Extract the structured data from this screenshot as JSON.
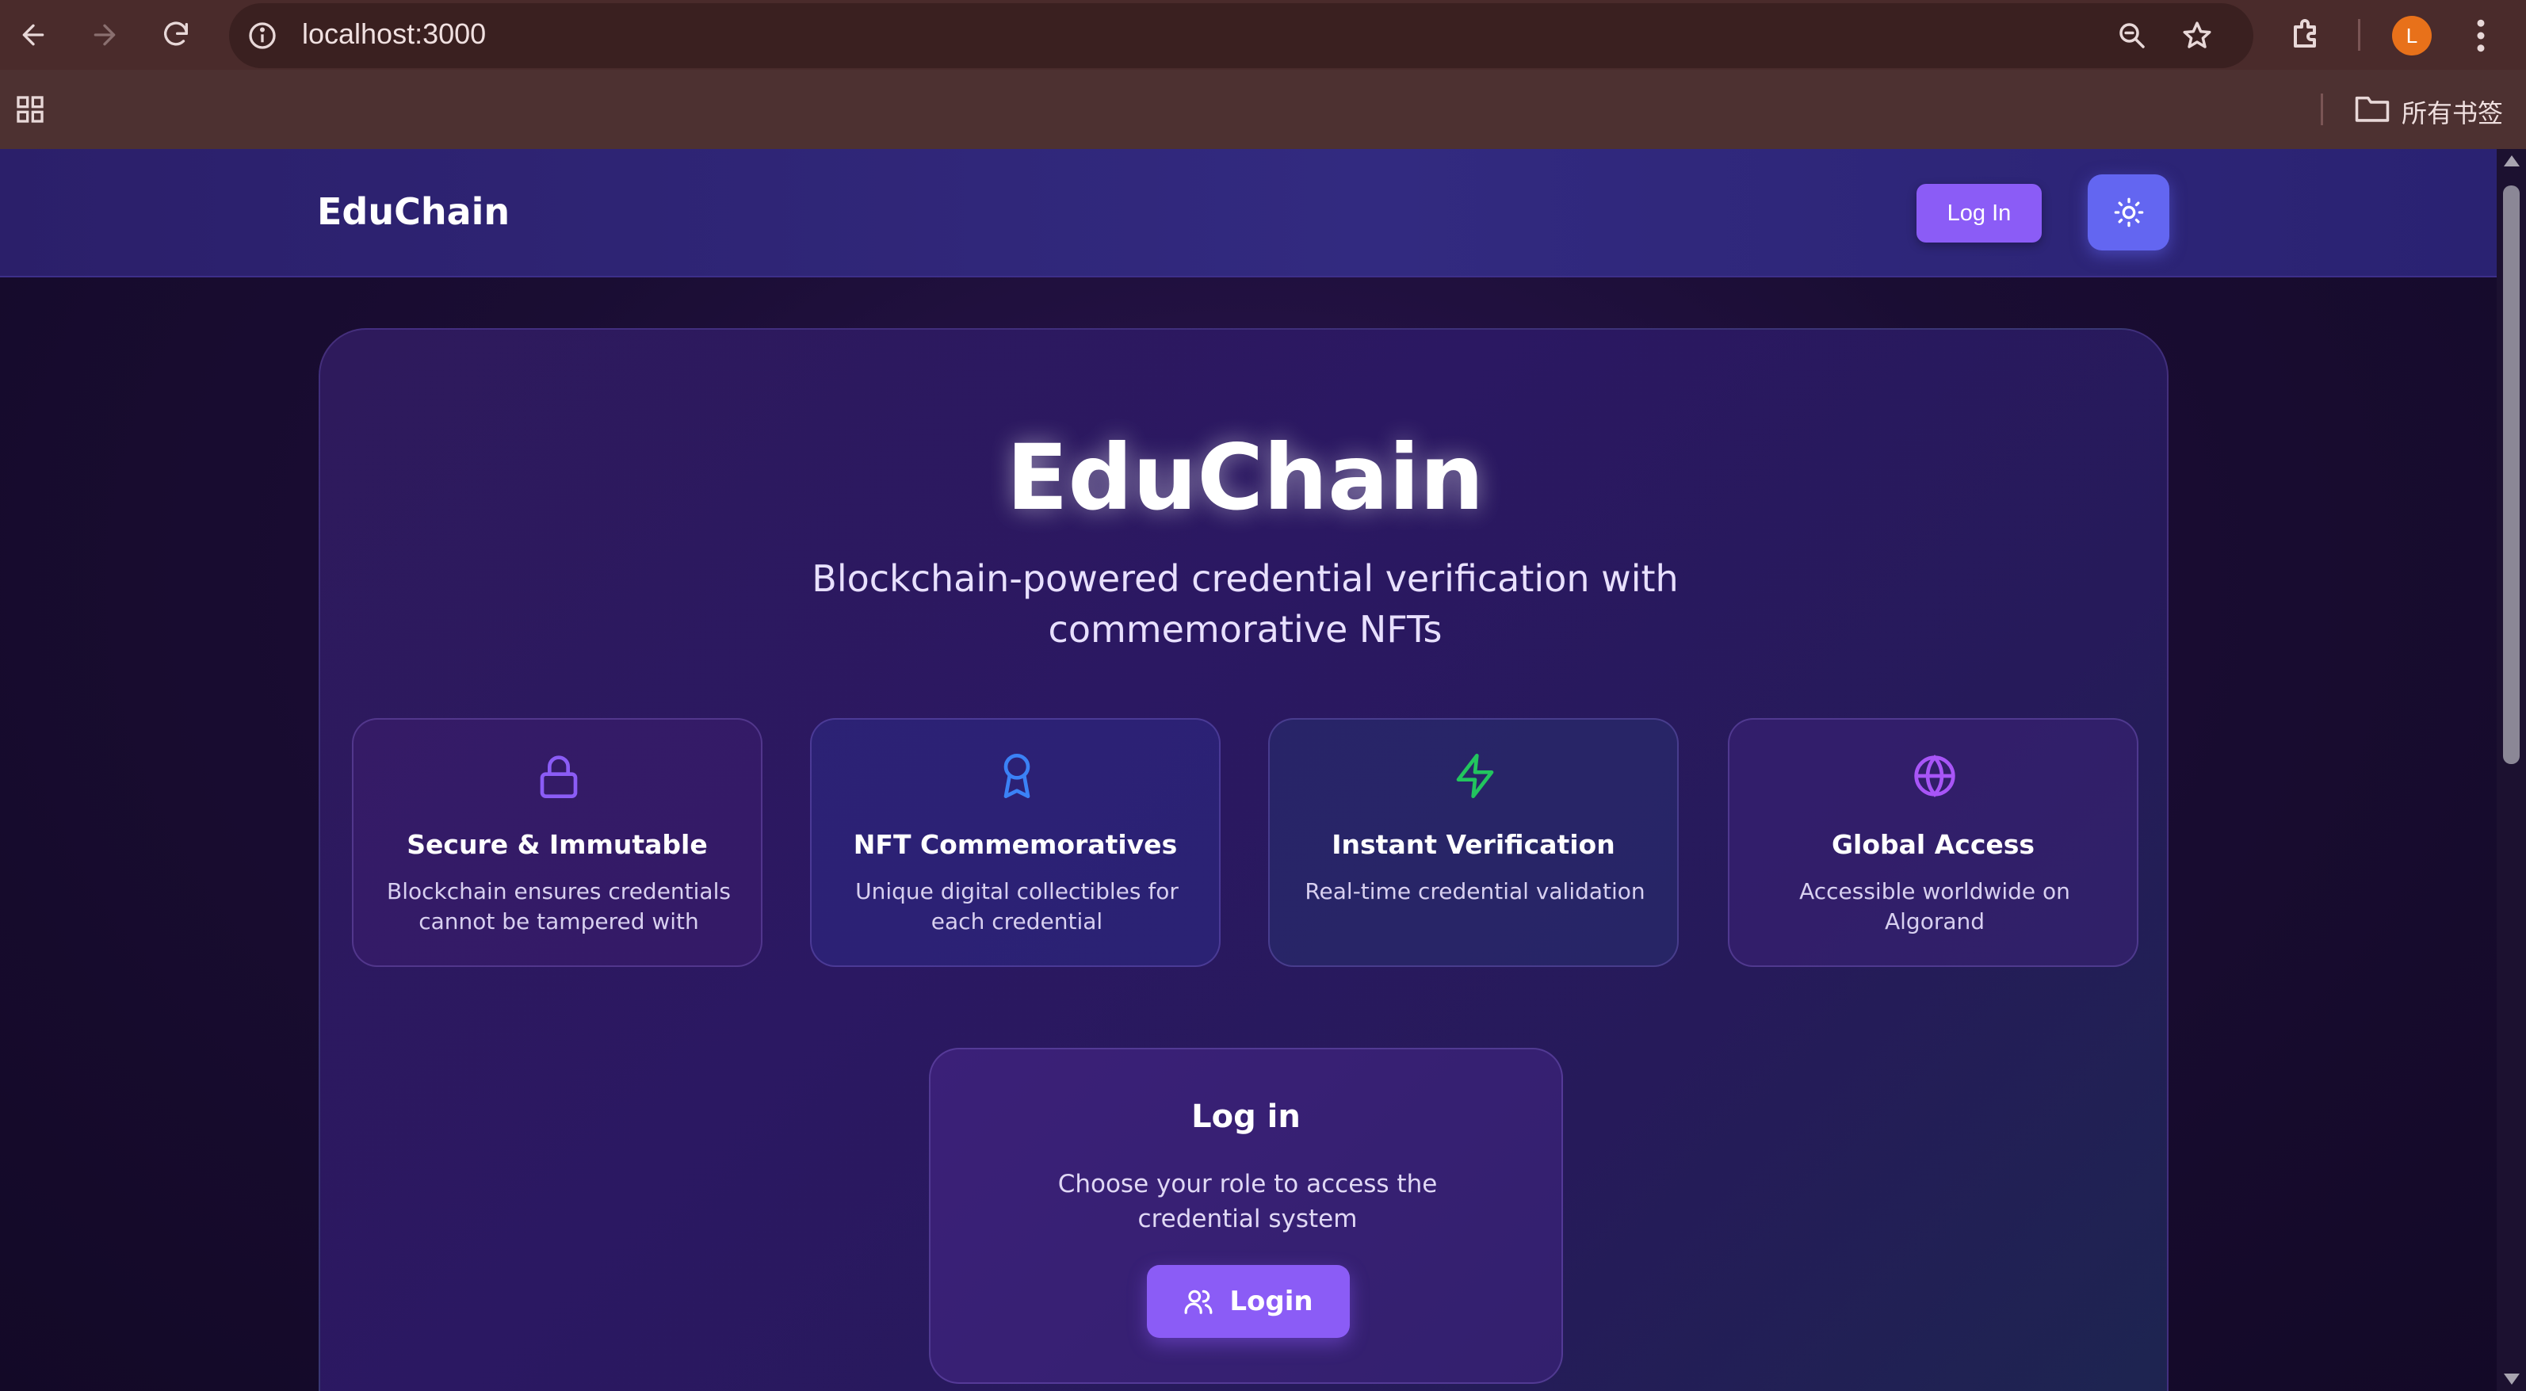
{
  "browser": {
    "url": "localhost:3000",
    "avatar_letter": "L",
    "bookmarks_label": "所有书签",
    "accent_color": "#e8711a"
  },
  "page": {
    "nav": {
      "brand": "EduChain",
      "login_label": "Log In"
    },
    "hero": {
      "title": "EduChain",
      "subtitle": "Blockchain-powered credential verification with commemorative NFTs"
    },
    "features": [
      {
        "icon": "lock-icon",
        "title": "Secure & Immutable",
        "description": "Blockchain ensures credentials cannot be tampered with",
        "color": "#8b5cf6"
      },
      {
        "icon": "award-icon",
        "title": "NFT Commemoratives",
        "description": "Unique digital collectibles for each credential",
        "color": "#3b82f6"
      },
      {
        "icon": "lightning-icon",
        "title": "Instant Verification",
        "description": "Real-time credential validation",
        "color": "#22c55e"
      },
      {
        "icon": "globe-icon",
        "title": "Global Access",
        "description": "Accessible worldwide on Algorand",
        "color": "#a855f7"
      }
    ],
    "login_card": {
      "title": "Log in",
      "description": "Choose your role to access the credential system",
      "button_label": "Login"
    },
    "colors": {
      "primary": "#8b5cf6",
      "theme_toggle": "#6366f1"
    }
  }
}
